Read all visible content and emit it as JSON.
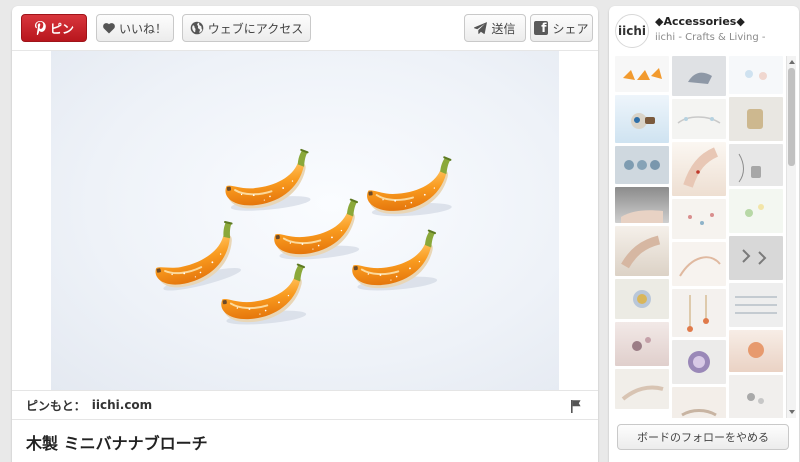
{
  "toolbar": {
    "pin_label": "ピン",
    "like_label": "いいね！",
    "visit_label": "ウェブにアクセス",
    "send_label": "送信",
    "share_label": "シェア"
  },
  "pin": {
    "source_label": "ピンもと：",
    "source_domain": "iichi.com",
    "title": "木製 ミニバナナブローチ"
  },
  "board": {
    "avatar_text": "iichi",
    "name": "◆Accessories◆",
    "owner": "iichi - Crafts & Living -",
    "follow_button_label": "ボードのフォローをやめる"
  },
  "colors": {
    "pin_red": "#cb2027",
    "banana_orange": "#f5951e",
    "stem_green": "#8aa83a"
  },
  "icons": {
    "pin": "pinterest-p-icon",
    "like": "heart-icon",
    "visit": "globe-icon",
    "send": "paper-plane-icon",
    "share": "facebook-icon",
    "report": "flag-icon"
  }
}
